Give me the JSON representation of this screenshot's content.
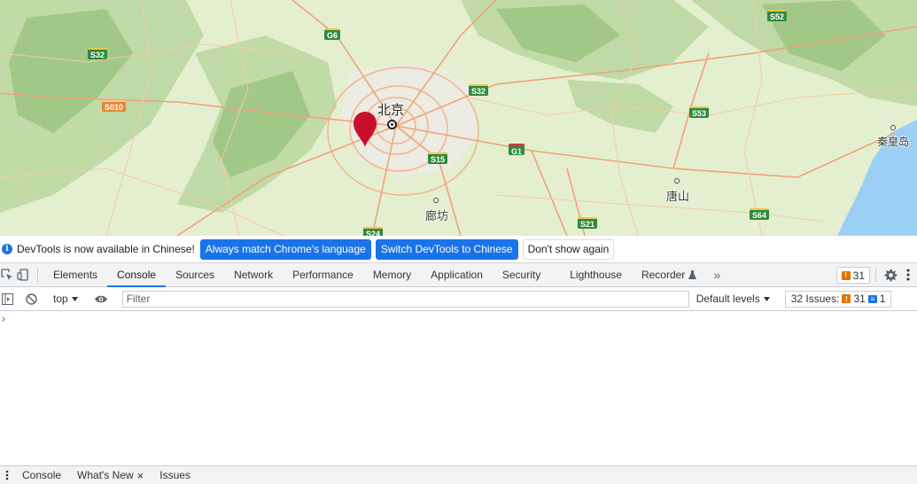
{
  "map": {
    "cities": [
      {
        "id": "beijing",
        "label": "北京"
      },
      {
        "id": "langfang",
        "label": "廊坊"
      },
      {
        "id": "tangshan",
        "label": "唐山"
      },
      {
        "id": "qinhuangdao",
        "label": "秦皇岛"
      }
    ],
    "road_shields": [
      "S52",
      "G6",
      "S32",
      "S010",
      "S32",
      "S53",
      "G1",
      "S15",
      "S21",
      "S64",
      "S24"
    ],
    "marker_color": "#c8102e"
  },
  "infobar": {
    "message": "DevTools is now available in Chinese!",
    "btn_match": "Always match Chrome's language",
    "btn_switch": "Switch DevTools to Chinese",
    "btn_dismiss": "Don't show again"
  },
  "devtools": {
    "tabs": [
      "Elements",
      "Console",
      "Sources",
      "Network",
      "Performance",
      "Memory",
      "Application",
      "Security",
      "Lighthouse",
      "Recorder"
    ],
    "active_tab": "Console",
    "more_tabs": "»",
    "warning_count": "31",
    "accent": "#1a73e8"
  },
  "filterbar": {
    "context": "top",
    "filter_placeholder": "Filter",
    "levels": "Default levels",
    "issues_label": "32 Issues:",
    "issues_warn": "31",
    "issues_info": "1"
  },
  "console": {
    "prompt": "›"
  },
  "drawer": {
    "tabs": [
      "Console",
      "What's New",
      "Issues"
    ],
    "close_glyph": "×"
  }
}
